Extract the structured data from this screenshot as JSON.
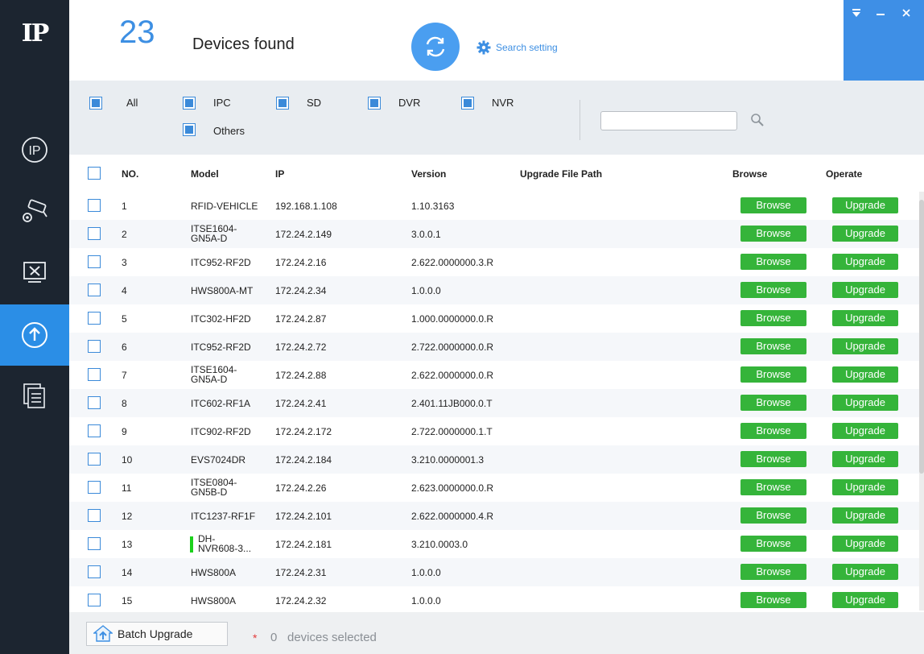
{
  "app": {
    "logo": "IP"
  },
  "sidebar": {
    "items": [
      {
        "name": "ip-search",
        "icon": "ip-icon"
      },
      {
        "name": "device-config",
        "icon": "camera-gear-icon"
      },
      {
        "name": "tools",
        "icon": "tools-icon"
      },
      {
        "name": "upgrade",
        "icon": "upload-circle-icon",
        "active": true
      },
      {
        "name": "docs",
        "icon": "documents-icon"
      }
    ]
  },
  "header": {
    "count": "23",
    "count_label": "Devices found",
    "search_setting": "Search setting"
  },
  "filters": {
    "items": [
      {
        "label": "All",
        "checked": true
      },
      {
        "label": "IPC",
        "checked": true
      },
      {
        "label": "SD",
        "checked": true
      },
      {
        "label": "DVR",
        "checked": true
      },
      {
        "label": "NVR",
        "checked": true
      },
      {
        "label": "Others",
        "checked": true
      }
    ],
    "search_value": ""
  },
  "table": {
    "columns": [
      "NO.",
      "Model",
      "IP",
      "Version",
      "Upgrade File Path",
      "Browse",
      "Operate"
    ],
    "browse_label": "Browse",
    "upgrade_label": "Upgrade",
    "rows": [
      {
        "no": "1",
        "model": "RFID-VEHICLE",
        "ip": "192.168.1.108",
        "version": "1.10.3163",
        "path": ""
      },
      {
        "no": "2",
        "model": "ITSE1604-\nGN5A-D",
        "ip": "172.24.2.149",
        "version": "3.0.0.1",
        "path": ""
      },
      {
        "no": "3",
        "model": "ITC952-RF2D",
        "ip": "172.24.2.16",
        "version": "2.622.0000000.3.R",
        "path": ""
      },
      {
        "no": "4",
        "model": "HWS800A-MT",
        "ip": "172.24.2.34",
        "version": "1.0.0.0",
        "path": ""
      },
      {
        "no": "5",
        "model": "ITC302-HF2D",
        "ip": "172.24.2.87",
        "version": "1.000.0000000.0.R",
        "path": ""
      },
      {
        "no": "6",
        "model": "ITC952-RF2D",
        "ip": "172.24.2.72",
        "version": "2.722.0000000.0.R",
        "path": ""
      },
      {
        "no": "7",
        "model": "ITSE1604-\nGN5A-D",
        "ip": "172.24.2.88",
        "version": "2.622.0000000.0.R",
        "path": ""
      },
      {
        "no": "8",
        "model": "ITC602-RF1A",
        "ip": "172.24.2.41",
        "version": "2.401.11JB000.0.T",
        "path": ""
      },
      {
        "no": "9",
        "model": "ITC902-RF2D",
        "ip": "172.24.2.172",
        "version": "2.722.0000000.1.T",
        "path": ""
      },
      {
        "no": "10",
        "model": "EVS7024DR",
        "ip": "172.24.2.184",
        "version": "3.210.0000001.3",
        "path": ""
      },
      {
        "no": "11",
        "model": "ITSE0804-\nGN5B-D",
        "ip": "172.24.2.26",
        "version": "2.623.0000000.0.R",
        "path": ""
      },
      {
        "no": "12",
        "model": "ITC1237-RF1F",
        "ip": "172.24.2.101",
        "version": "2.622.0000000.4.R",
        "path": ""
      },
      {
        "no": "13",
        "model": "DH-\nNVR608-3...",
        "ip": "172.24.2.181",
        "version": "3.210.0003.0",
        "path": "",
        "status_bar": true
      },
      {
        "no": "14",
        "model": "HWS800A",
        "ip": "172.24.2.31",
        "version": "1.0.0.0",
        "path": ""
      },
      {
        "no": "15",
        "model": "HWS800A",
        "ip": "172.24.2.32",
        "version": "1.0.0.0",
        "path": ""
      }
    ]
  },
  "footer": {
    "batch_label": "Batch Upgrade",
    "star": "*",
    "selected_count": "0",
    "selected_text": "devices selected"
  },
  "colors": {
    "sidebar": "#1c2530",
    "accent": "#3d8fe3",
    "button_green": "#35b43a"
  }
}
